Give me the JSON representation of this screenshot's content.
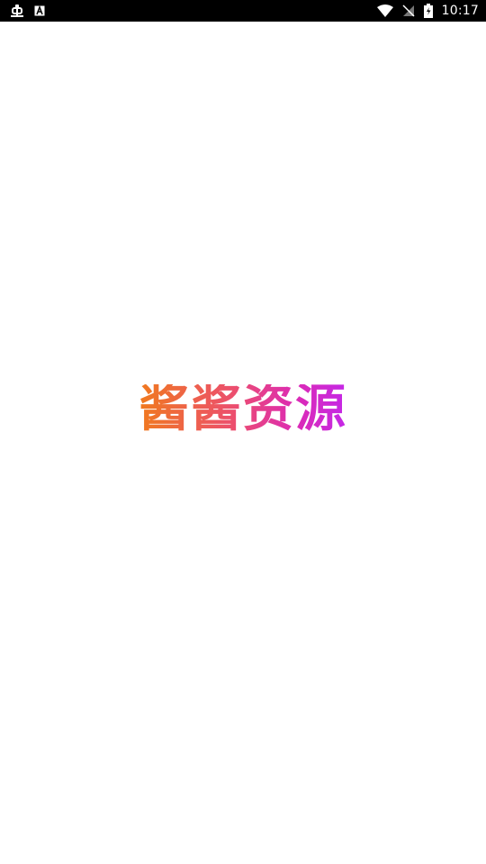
{
  "status_bar": {
    "time": "10:17",
    "left_icons": [
      "debug-bug-icon",
      "a-badge-icon"
    ],
    "right_icons": [
      "wifi-icon",
      "no-sim-icon",
      "battery-icon"
    ]
  },
  "splash": {
    "title": "酱酱资源",
    "gradient": [
      "#f07a1e",
      "#ec4f6d",
      "#dc2bb4",
      "#c428e8"
    ]
  }
}
